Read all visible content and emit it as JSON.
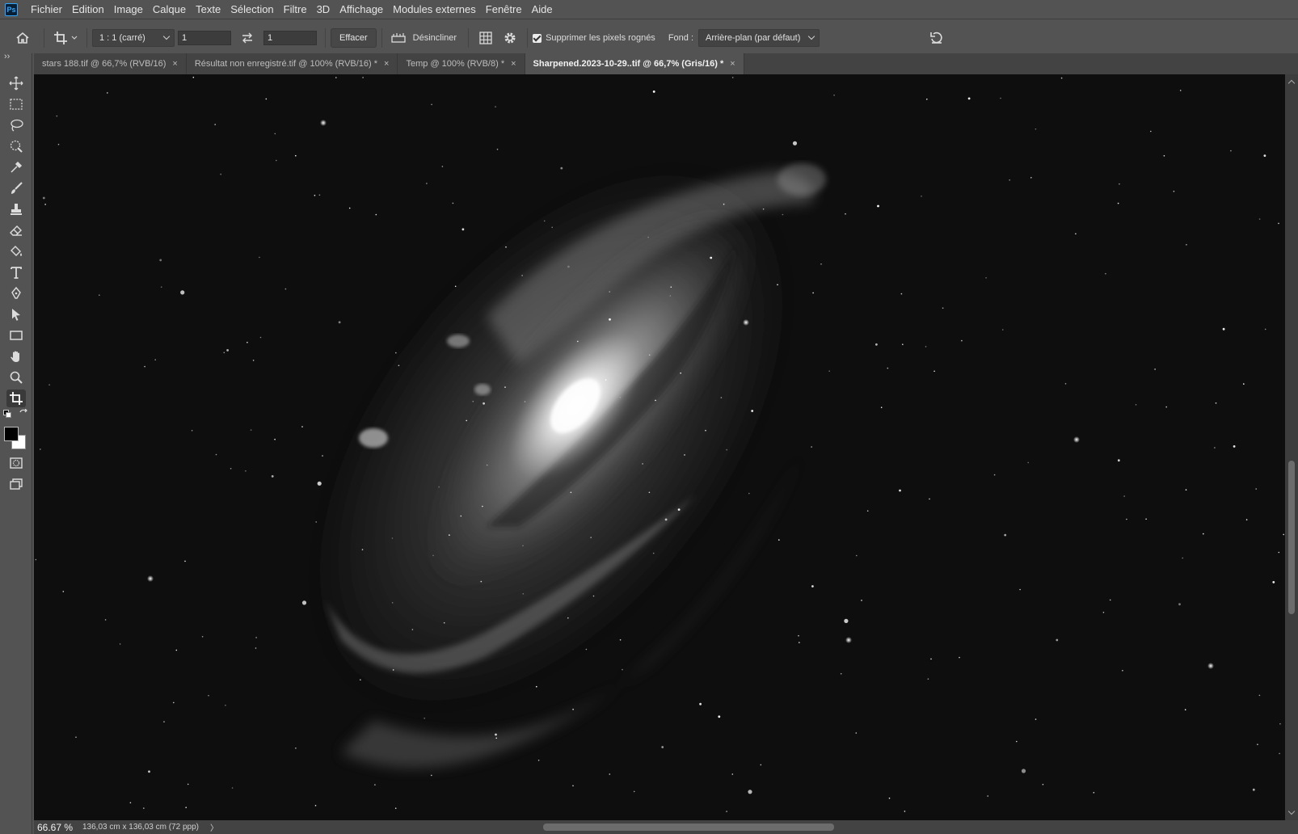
{
  "app": {
    "logo": "Ps"
  },
  "menu": [
    "Fichier",
    "Edition",
    "Image",
    "Calque",
    "Texte",
    "Sélection",
    "Filtre",
    "3D",
    "Affichage",
    "Modules externes",
    "Fenêtre",
    "Aide"
  ],
  "options": {
    "ratio_select": "1 : 1 (carré)",
    "width_value": "1",
    "height_value": "1",
    "clear_button": "Effacer",
    "straighten_label": "Désincliner",
    "delete_cropped_label": "Supprimer les pixels rognés",
    "delete_cropped_checked": true,
    "fill_label": "Fond :",
    "fill_select": "Arrière-plan (par défaut)"
  },
  "tabs": [
    {
      "label": "stars 188.tif @ 66,7% (RVB/16)",
      "close": "×",
      "active": false
    },
    {
      "label": "Résultat non enregistré.tif @ 100% (RVB/16) *",
      "close": "×",
      "active": false
    },
    {
      "label": "Temp @ 100% (RVB/8) *",
      "close": "×",
      "active": false
    },
    {
      "label": "Sharpened.2023-10-29..tif @ 66,7% (Gris/16) *",
      "close": "×",
      "active": true
    }
  ],
  "toolbar": {
    "collapse": "››",
    "tools": [
      "move-tool",
      "marquee-tool",
      "lasso-tool",
      "quick-selection-tool",
      "eyedropper-tool",
      "brush-tool",
      "stamp-tool",
      "eraser-tool",
      "paint-bucket-tool",
      "type-tool",
      "pen-tool",
      "path-selection-tool",
      "rectangle-tool",
      "hand-tool",
      "zoom-tool",
      "crop-tool"
    ],
    "active_tool": "crop-tool",
    "foreground_color": "#000000",
    "background_color": "#ffffff"
  },
  "status": {
    "zoom": "66.67 %",
    "doc_info": "136,03 cm x 136,03 cm (72 ppp)",
    "arrow": "〉"
  },
  "colors": {
    "ui_bg": "#535353",
    "tab_bg": "#434343",
    "canvas_bg": "#0d0d0e",
    "accent": "#31a8ff"
  }
}
